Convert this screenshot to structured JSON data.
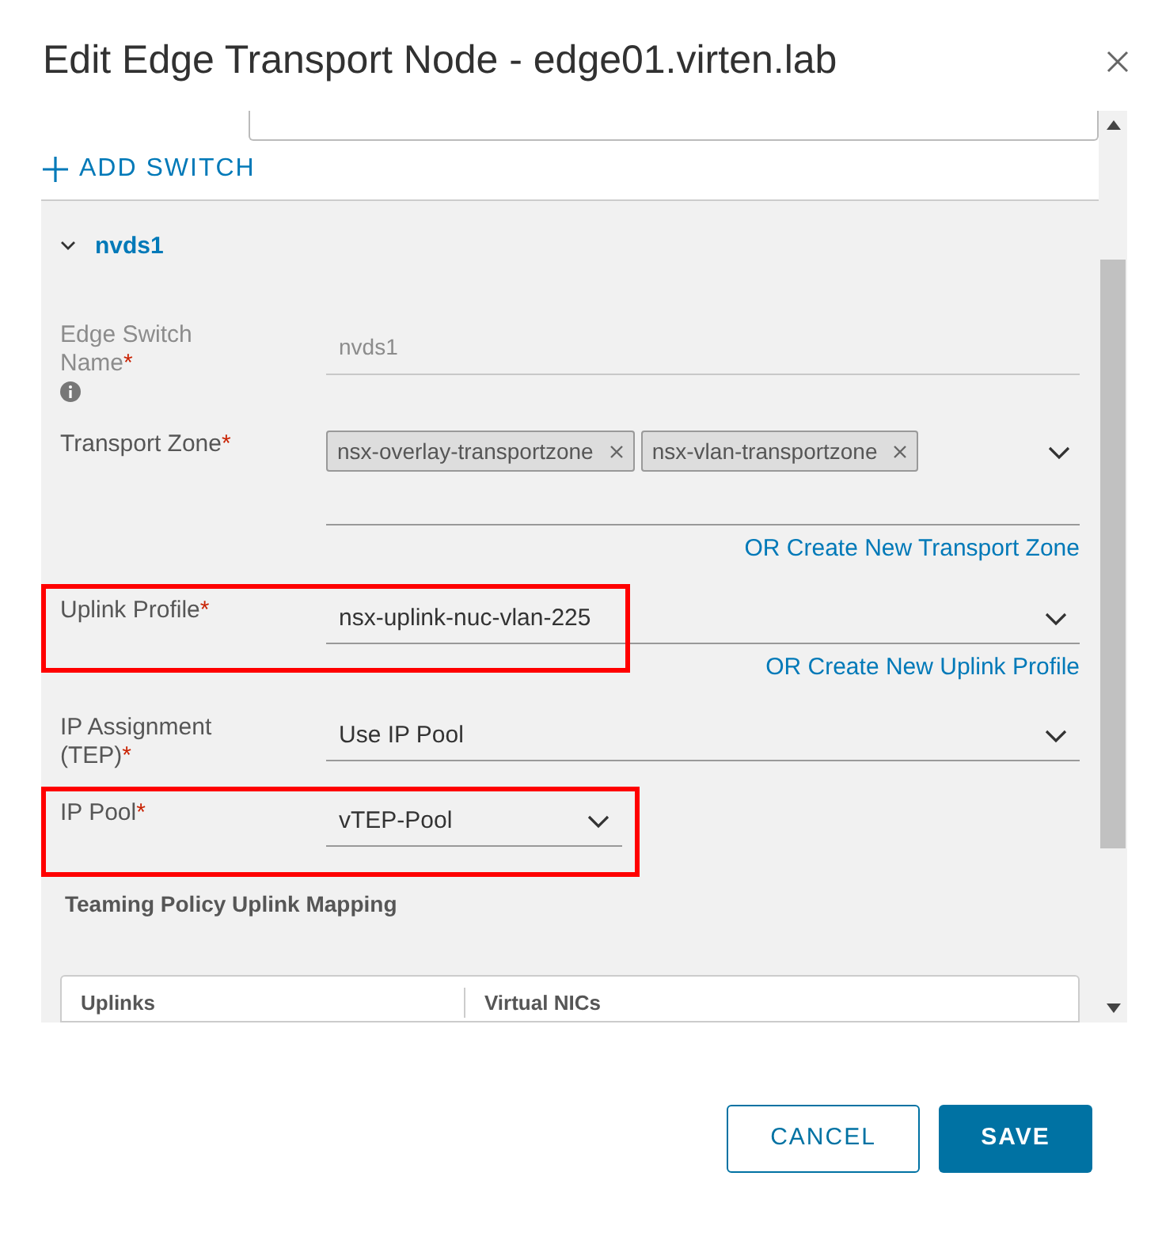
{
  "dialog": {
    "title": "Edit Edge Transport Node - edge01.virten.lab"
  },
  "add_switch": {
    "label": "ADD SWITCH"
  },
  "switch": {
    "name": "nvds1",
    "expanded": true,
    "fields": [
      {
        "kind": "text",
        "label": "Edge Switch Name",
        "required": "*",
        "info": true,
        "value": "nvds1",
        "disabled": true,
        "highlighted": false
      },
      {
        "kind": "multiselect",
        "label": "Transport Zone",
        "required": "*",
        "chips": [
          "nsx-overlay-transportzone",
          "nsx-vlan-transportzone"
        ],
        "link": "OR Create New Transport Zone",
        "highlighted": false
      },
      {
        "kind": "select",
        "label": "Uplink Profile",
        "required": "*",
        "value": "nsx-uplink-nuc-vlan-225",
        "link": "OR Create New Uplink Profile",
        "highlighted": true
      },
      {
        "kind": "select",
        "label": "IP Assignment (TEP)",
        "required": "*",
        "value": "Use IP Pool",
        "highlighted": false
      },
      {
        "kind": "compact-select",
        "label": "IP Pool",
        "required": "*",
        "value": "vTEP-Pool",
        "highlighted": true
      }
    ],
    "teaming": {
      "title": "Teaming Policy Uplink Mapping",
      "columns": [
        "Uplinks",
        "Virtual NICs"
      ]
    }
  },
  "buttons": [
    {
      "kind": "secondary",
      "label": "CANCEL"
    },
    {
      "kind": "primary",
      "label": "SAVE"
    }
  ]
}
